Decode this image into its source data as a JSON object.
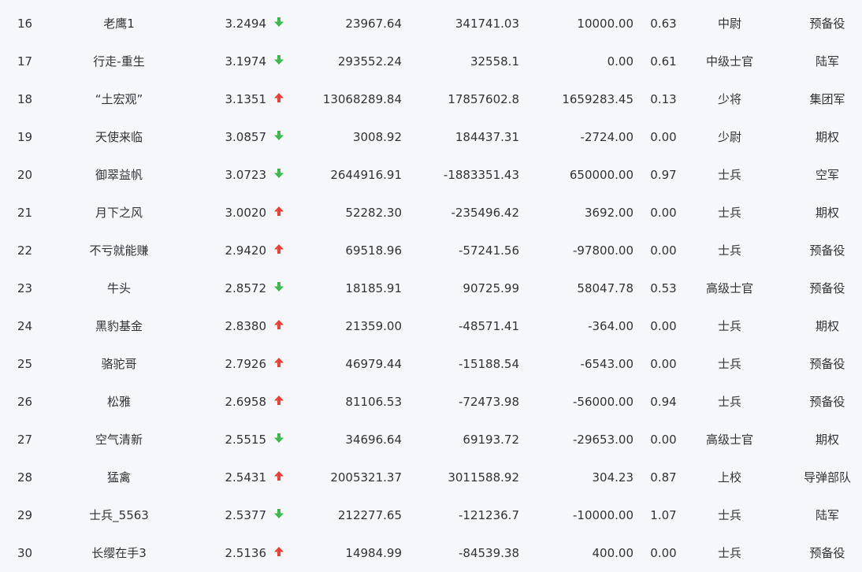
{
  "colors": {
    "background": "#f5f7fa",
    "text": "#333333",
    "up_arrow": "#e8403c",
    "down_arrow": "#3cb850"
  },
  "rows": [
    {
      "rank": "16",
      "name": "老鹰1",
      "score": "3.2494",
      "trend": "down",
      "v1": "23967.64",
      "v2": "341741.03",
      "v3": "10000.00",
      "ratio": "0.63",
      "title": "中尉",
      "unit": "预备役"
    },
    {
      "rank": "17",
      "name": "行走-重生",
      "score": "3.1974",
      "trend": "down",
      "v1": "293552.24",
      "v2": "32558.1",
      "v3": "0.00",
      "ratio": "0.61",
      "title": "中级士官",
      "unit": "陆军"
    },
    {
      "rank": "18",
      "name": "“土宏观”",
      "score": "3.1351",
      "trend": "up",
      "v1": "13068289.84",
      "v2": "17857602.8",
      "v3": "1659283.45",
      "ratio": "0.13",
      "title": "少将",
      "unit": "集团军"
    },
    {
      "rank": "19",
      "name": "天使来临",
      "score": "3.0857",
      "trend": "down",
      "v1": "3008.92",
      "v2": "184437.31",
      "v3": "-2724.00",
      "ratio": "0.00",
      "title": "少尉",
      "unit": "期权"
    },
    {
      "rank": "20",
      "name": "御翠益帆",
      "score": "3.0723",
      "trend": "down",
      "v1": "2644916.91",
      "v2": "-1883351.43",
      "v3": "650000.00",
      "ratio": "0.97",
      "title": "士兵",
      "unit": "空军"
    },
    {
      "rank": "21",
      "name": "月下之风",
      "score": "3.0020",
      "trend": "up",
      "v1": "52282.30",
      "v2": "-235496.42",
      "v3": "3692.00",
      "ratio": "0.00",
      "title": "士兵",
      "unit": "期权"
    },
    {
      "rank": "22",
      "name": "不亏就能赚",
      "score": "2.9420",
      "trend": "up",
      "v1": "69518.96",
      "v2": "-57241.56",
      "v3": "-97800.00",
      "ratio": "0.00",
      "title": "士兵",
      "unit": "预备役"
    },
    {
      "rank": "23",
      "name": "牛头",
      "score": "2.8572",
      "trend": "down",
      "v1": "18185.91",
      "v2": "90725.99",
      "v3": "58047.78",
      "ratio": "0.53",
      "title": "高级士官",
      "unit": "预备役"
    },
    {
      "rank": "24",
      "name": "黑豹基金",
      "score": "2.8380",
      "trend": "up",
      "v1": "21359.00",
      "v2": "-48571.41",
      "v3": "-364.00",
      "ratio": "0.00",
      "title": "士兵",
      "unit": "期权"
    },
    {
      "rank": "25",
      "name": "骆驼哥",
      "score": "2.7926",
      "trend": "up",
      "v1": "46979.44",
      "v2": "-15188.54",
      "v3": "-6543.00",
      "ratio": "0.00",
      "title": "士兵",
      "unit": "预备役"
    },
    {
      "rank": "26",
      "name": "松雅",
      "score": "2.6958",
      "trend": "up",
      "v1": "81106.53",
      "v2": "-72473.98",
      "v3": "-56000.00",
      "ratio": "0.94",
      "title": "士兵",
      "unit": "预备役"
    },
    {
      "rank": "27",
      "name": "空气清新",
      "score": "2.5515",
      "trend": "down",
      "v1": "34696.64",
      "v2": "69193.72",
      "v3": "-29653.00",
      "ratio": "0.00",
      "title": "高级士官",
      "unit": "期权"
    },
    {
      "rank": "28",
      "name": "猛禽",
      "score": "2.5431",
      "trend": "up",
      "v1": "2005321.37",
      "v2": "3011588.92",
      "v3": "304.23",
      "ratio": "0.87",
      "title": "上校",
      "unit": "导弹部队"
    },
    {
      "rank": "29",
      "name": "士兵_5563",
      "score": "2.5377",
      "trend": "down",
      "v1": "212277.65",
      "v2": "-121236.7",
      "v3": "-10000.00",
      "ratio": "1.07",
      "title": "士兵",
      "unit": "陆军"
    },
    {
      "rank": "30",
      "name": "长缨在手3",
      "score": "2.5136",
      "trend": "up",
      "v1": "14984.99",
      "v2": "-84539.38",
      "v3": "400.00",
      "ratio": "0.00",
      "title": "士兵",
      "unit": "预备役"
    }
  ]
}
